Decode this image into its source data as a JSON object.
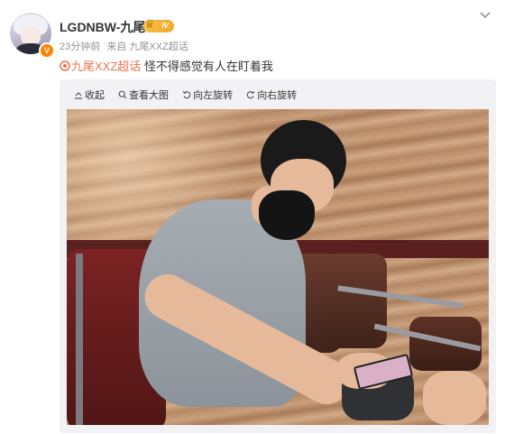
{
  "user": {
    "name": "LGDNBW-九尾",
    "level_label": "IV",
    "verified_badge": "V"
  },
  "meta": {
    "time": "23分钟前",
    "source": "来自 九尾XXZ超话"
  },
  "post": {
    "topic": "九尾XXZ超话",
    "text": "怪不得感觉有人在盯着我"
  },
  "toolbar": {
    "collapse": "收起",
    "view_large": "查看大图",
    "rotate_left": "向左旋转",
    "rotate_right": "向右旋转"
  },
  "colors": {
    "topic": "#eb7350",
    "vip_orange": "#ff8200",
    "meta_gray": "#939393",
    "panel": "#f2f2f5"
  },
  "icons": [
    "more-icon",
    "verified-icon",
    "level-icon",
    "topic-icon",
    "collapse-icon",
    "zoom-icon",
    "rotate-left-icon",
    "rotate-right-icon"
  ]
}
